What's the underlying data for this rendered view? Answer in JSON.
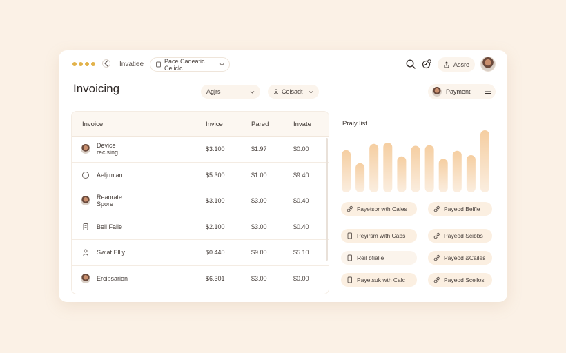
{
  "header": {
    "breadcrumb": "Invatiee",
    "chip_label": "Pace Cadeatic Celiclc",
    "share_label": "Assre",
    "title": "Invoicing",
    "select_1": "Agjrs",
    "select_2": "Celsadt",
    "payment_label": "Payment"
  },
  "table": {
    "columns": [
      "Invoice",
      "Invice",
      "Pared",
      "Invate"
    ],
    "rows": [
      {
        "name": "Device\nrecising",
        "icon": "avatar",
        "a": "$3.100",
        "b": "$1.97",
        "c": "$0.00"
      },
      {
        "name": "Aeljrmian",
        "icon": "circle-icon",
        "a": "$5.300",
        "b": "$1.00",
        "c": "$9.40"
      },
      {
        "name": "Reaorate\nSpore",
        "icon": "avatar",
        "a": "$3.100",
        "b": "$3.00",
        "c": "$0.40"
      },
      {
        "name": "Bell Falle",
        "icon": "receipt-icon",
        "a": "$2.100",
        "b": "$3.00",
        "c": "$0.40"
      },
      {
        "name": "Swiat Elliy",
        "icon": "user-icon",
        "a": "$0.440",
        "b": "$9.00",
        "c": "$5.10"
      },
      {
        "name": "Ercipsarion",
        "icon": "avatar",
        "a": "$6.301",
        "b": "$3.00",
        "c": "$0.00"
      }
    ]
  },
  "panel": {
    "title": "Praiy list",
    "buttons": [
      {
        "label": "Fayetsor wth Cales",
        "icon": "link-icon"
      },
      {
        "label": "Payeod Belfle",
        "icon": "link-icon"
      },
      {
        "label": "Peyirsm with Cabs",
        "icon": "card-icon"
      },
      {
        "label": "Payeod Scibbs",
        "icon": "link-icon"
      },
      {
        "label": "Reil bfialle",
        "icon": "card-icon"
      },
      {
        "label": "Payeod &Cailes",
        "icon": "link-icon"
      },
      {
        "label": "Payetsuk wth Calc",
        "icon": "card-icon"
      },
      {
        "label": "Payeod Scellos",
        "icon": "link-icon"
      }
    ]
  },
  "chart_data": {
    "type": "bar",
    "categories": [
      "1",
      "2",
      "3",
      "4",
      "5",
      "6",
      "7",
      "8",
      "9",
      "10",
      "11"
    ],
    "values": [
      0.68,
      0.47,
      0.78,
      0.8,
      0.58,
      0.75,
      0.76,
      0.54,
      0.67,
      0.6,
      1.0
    ],
    "ylim": [
      0,
      1
    ],
    "colors": {
      "top": "#f5cea1",
      "bottom": "#fbeee0"
    }
  },
  "colors": {
    "accent": "#e2b24a",
    "background": "#fbf1e6",
    "pill": "#fbefe1"
  }
}
